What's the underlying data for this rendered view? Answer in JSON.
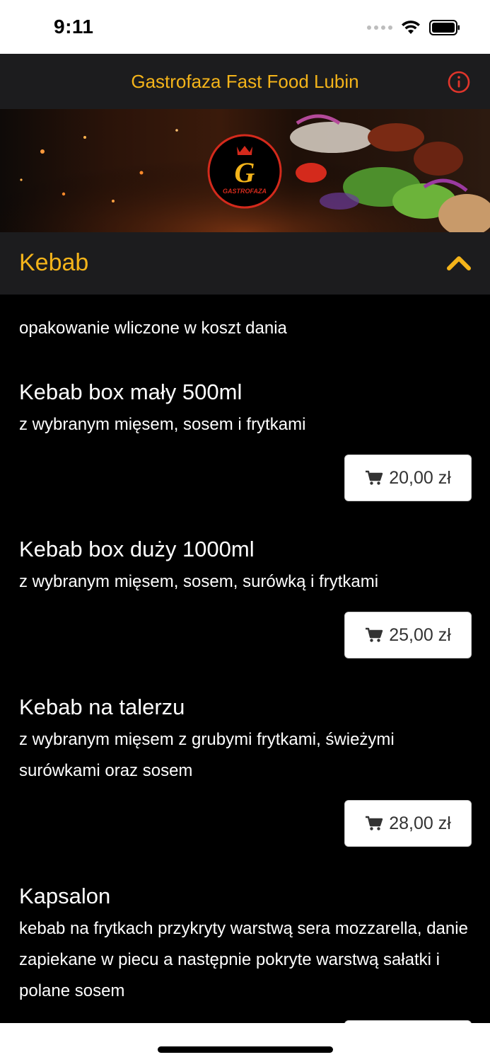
{
  "status_bar": {
    "time": "9:11"
  },
  "header": {
    "title": "Gastrofaza Fast Food Lubin"
  },
  "banner": {
    "logo_letter": "G",
    "logo_text": "GASTROFAZA"
  },
  "category": {
    "title": "Kebab"
  },
  "menu": {
    "note": "opakowanie wliczone w koszt dania",
    "items": [
      {
        "name": "Kebab box mały 500ml",
        "desc": "z wybranym mięsem, sosem i frytkami",
        "price": "20,00 zł"
      },
      {
        "name": "Kebab box duży 1000ml",
        "desc": "z wybranym mięsem, sosem, surówką i frytkami",
        "price": "25,00 zł"
      },
      {
        "name": "Kebab na talerzu",
        "desc": "z wybranym mięsem z grubymi frytkami, świeżymi surówkami oraz sosem",
        "price": "28,00 zł"
      },
      {
        "name": "Kapsalon",
        "desc": "kebab na frytkach przykryty warstwą sera mozzarella, danie zapiekane w piecu a następnie pokryte warstwą sałatki i polane sosem",
        "price": ""
      }
    ]
  },
  "colors": {
    "accent": "#f4b41a",
    "info_red": "#e0352b",
    "header_bg": "#1c1c1e",
    "background": "#000000"
  },
  "icons": {
    "info": "info-circle-icon",
    "collapse": "chevron-up-icon",
    "cart": "cart-icon"
  }
}
